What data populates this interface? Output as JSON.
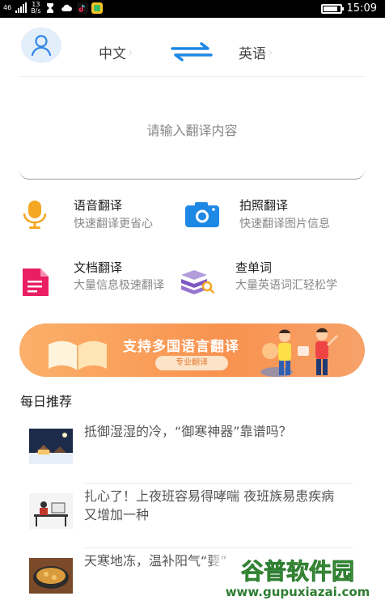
{
  "status_bar": {
    "network": "46",
    "speed_value": "13",
    "speed_unit": "B/s",
    "time": "15:09",
    "battery_level": 0.85
  },
  "translator": {
    "source_lang": "中文",
    "target_lang": "英语",
    "input_placeholder": "请输入翻译内容"
  },
  "features": [
    {
      "title": "语音翻译",
      "desc": "快速翻译更省心",
      "icon": "microphone-icon"
    },
    {
      "title": "拍照翻译",
      "desc": "快速翻译图片信息",
      "icon": "camera-icon"
    },
    {
      "title": "文档翻译",
      "desc": "大量信息极速翻译",
      "icon": "document-icon"
    },
    {
      "title": "查单词",
      "desc": "大量英语词汇轻松学",
      "icon": "books-search-icon"
    }
  ],
  "banner": {
    "headline": "支持多国语言翻译",
    "button": "专业翻译"
  },
  "daily": {
    "title": "每日推荐",
    "items": [
      {
        "text": "抵御湿湿的冷，“御寒神器”靠谱吗？"
      },
      {
        "text": "扎心了！上夜班容易得哮喘 夜班族易患疾病又增加一种"
      },
      {
        "text": "天寒地冻，温补阳气“要”"
      }
    ]
  },
  "watermark": {
    "brand": "谷普软件园",
    "url": "www.gupuxiazai.com"
  },
  "colors": {
    "accent_blue": "#1e88e5",
    "mic_orange": "#f5a623",
    "doc_pink": "#e91e63",
    "books_purple": "#7e57c2",
    "banner_orange": "#f8924f"
  }
}
